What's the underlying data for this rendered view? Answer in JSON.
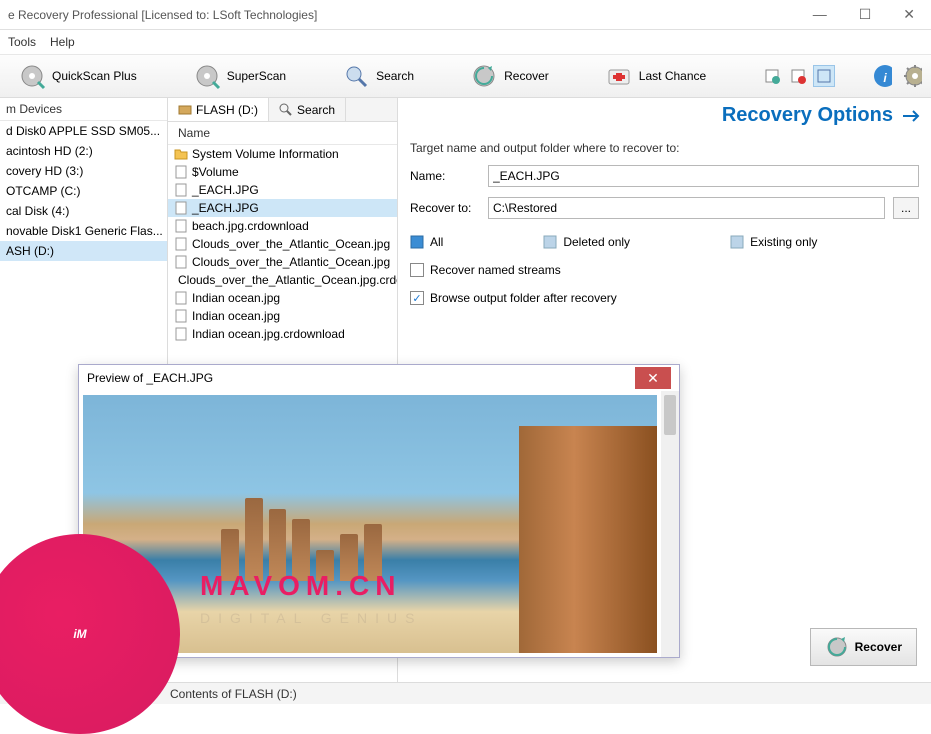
{
  "window": {
    "title": "e Recovery Professional [Licensed to: LSoft Technologies]"
  },
  "menu": {
    "tools": "Tools",
    "help": "Help"
  },
  "toolbar": {
    "quickscan": "QuickScan Plus",
    "superscan": "SuperScan",
    "search": "Search",
    "recover": "Recover",
    "lastchance": "Last Chance"
  },
  "devices": {
    "header": "m Devices",
    "items": [
      "d Disk0 APPLE SSD SM05...",
      "acintosh HD (2:)",
      "covery HD (3:)",
      "OTCAMP (C:)",
      "cal Disk (4:)",
      "novable Disk1 Generic Flas...",
      "ASH (D:)"
    ],
    "selected": 6
  },
  "tabs": {
    "current": "FLASH (D:)",
    "search": "Search"
  },
  "filelist": {
    "header": "Name",
    "items": [
      {
        "icon": "folder",
        "name": "System Volume Information"
      },
      {
        "icon": "file",
        "name": "$Volume"
      },
      {
        "icon": "file",
        "name": "_EACH.JPG"
      },
      {
        "icon": "file",
        "name": "_EACH.JPG"
      },
      {
        "icon": "file",
        "name": "beach.jpg.crdownload"
      },
      {
        "icon": "file",
        "name": "Clouds_over_the_Atlantic_Ocean.jpg"
      },
      {
        "icon": "file",
        "name": "Clouds_over_the_Atlantic_Ocean.jpg"
      },
      {
        "icon": "file",
        "name": "Clouds_over_the_Atlantic_Ocean.jpg.crdownload"
      },
      {
        "icon": "file",
        "name": "Indian ocean.jpg"
      },
      {
        "icon": "file",
        "name": "Indian ocean.jpg"
      },
      {
        "icon": "file",
        "name": "Indian ocean.jpg.crdownload"
      }
    ],
    "selected": 3
  },
  "recovery": {
    "title": "Recovery Options",
    "instruction": "Target name and output folder where to recover to:",
    "name_label": "Name:",
    "name_value": "_EACH.JPG",
    "recoverto_label": "Recover to:",
    "recoverto_value": "C:\\Restored",
    "browse_btn": "...",
    "opt_all": "All",
    "opt_deleted": "Deleted only",
    "opt_existing": "Existing only",
    "chk_streams": "Recover named streams",
    "chk_browse": "Browse output folder after recovery",
    "recover_btn": "Recover"
  },
  "preview": {
    "title": "Preview of _EACH.JPG"
  },
  "status": {
    "text": "Contents of FLASH (D:)"
  },
  "watermark": {
    "logo": "iM",
    "text": "MAVOM.CN",
    "sub": "DIGITAL GENIUS"
  }
}
